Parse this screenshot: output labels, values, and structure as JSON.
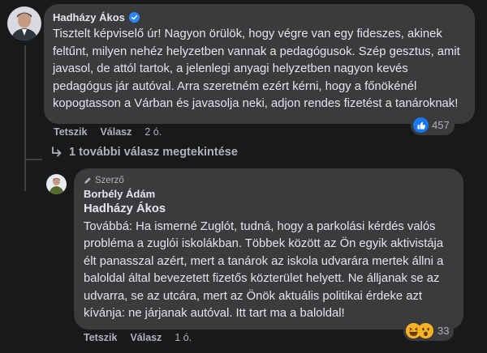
{
  "comment1": {
    "author": "Hadházy Ákos",
    "text": "Tisztelt képviselő úr! Nagyon örülök, hogy végre van egy fideszes, akinek feltűnt, milyen nehéz helyzetben vannak a pedagógusok. Szép gesztus, amit javasol, de attól tartok, a jelenlegi anyagi helyzetben nagyon kevés pedagógus jár autóval. Arra szeretném ezért kérni, hogy a főnökénél kopogtasson a Várban és javasolja neki, adjon rendes fizetést a tanároknak!",
    "like_label": "Tetszik",
    "reply_label": "Válasz",
    "time": "2 ó.",
    "reaction_count": "457",
    "reaction_icon": "like-icon"
  },
  "more_replies": {
    "label": "1 további válasz megtekintése"
  },
  "comment2": {
    "badge": "Szerző",
    "author": "Borbély Ádám",
    "mention": "Hadházy Ákos",
    "text": "Továbbá: Ha ismerné Zuglót, tudná, hogy a parkolási kérdés valós probléma a zuglói iskolákban. Többek között az Ön egyik aktivistája élt panasszal azért, mert a tanárok az iskola udvarára mertek állni a baloldal által bevezetett fizetős közterület helyett. Ne álljanak se az udvarra, se az utcára, mert az Önök aktuális politikai érdeke azt kívánja: ne járjanak autóval. Itt tart ma a baloldal!",
    "like_label": "Tetszik",
    "reply_label": "Válasz",
    "time": "1 ó.",
    "reaction_count": "33",
    "reaction_icons": [
      "haha-icon",
      "wow-icon"
    ]
  },
  "colors": {
    "background": "#18191a",
    "bubble": "#3a3b3c",
    "text": "#e4e6eb",
    "muted": "#b0b3b8",
    "like_blue": "#1877f2",
    "verified_blue": "#2d88ff",
    "haha_yellow": "#f7b125"
  }
}
